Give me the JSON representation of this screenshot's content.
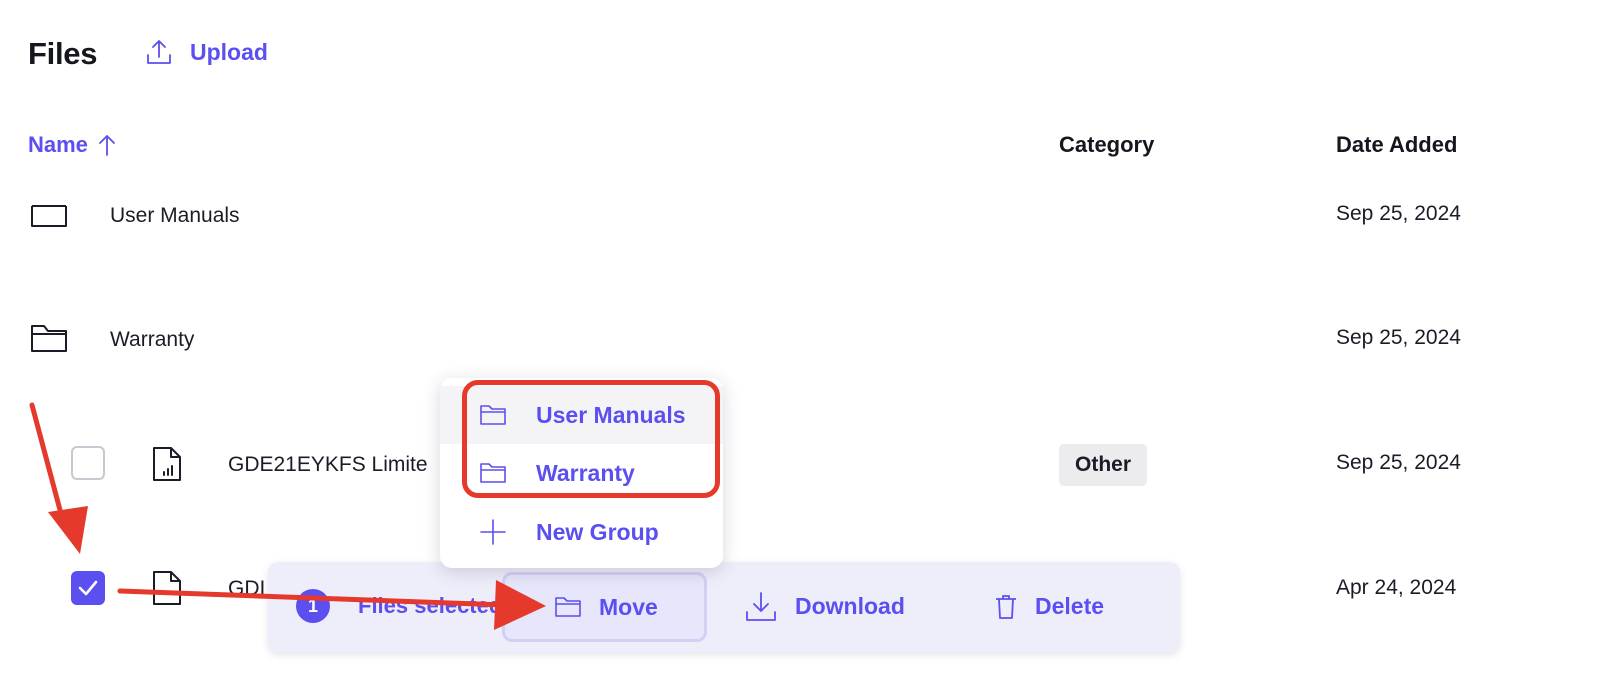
{
  "page": {
    "title": "Files",
    "upload_label": "Upload"
  },
  "table": {
    "headers": {
      "name": "Name",
      "category": "Category",
      "date_added": "Date Added"
    },
    "rows": [
      {
        "name": "User Manuals",
        "type": "folder",
        "category": "",
        "date": "Sep 25, 2024"
      },
      {
        "name": "Warranty",
        "type": "folder",
        "category": "",
        "date": "Sep 25, 2024"
      },
      {
        "name": "GDE21EYKFS Limite",
        "type": "file",
        "category": "Other",
        "date": "Sep 25, 2024",
        "checked": false
      },
      {
        "name": "GDI",
        "type": "file",
        "category": "",
        "date": "Apr 24, 2024",
        "checked": true
      }
    ]
  },
  "action_bar": {
    "count": "1",
    "selected_label": "Files selected",
    "move_label": "Move",
    "download_label": "Download",
    "delete_label": "Delete"
  },
  "move_menu": {
    "items": [
      {
        "label": "User Manuals",
        "icon": "folder-icon"
      },
      {
        "label": "Warranty",
        "icon": "folder-icon"
      },
      {
        "label": "New Group",
        "icon": "plus-icon"
      }
    ]
  },
  "colors": {
    "accent": "#5b4ff0",
    "annotation": "#e5392c",
    "badge_bg": "#ececef"
  }
}
